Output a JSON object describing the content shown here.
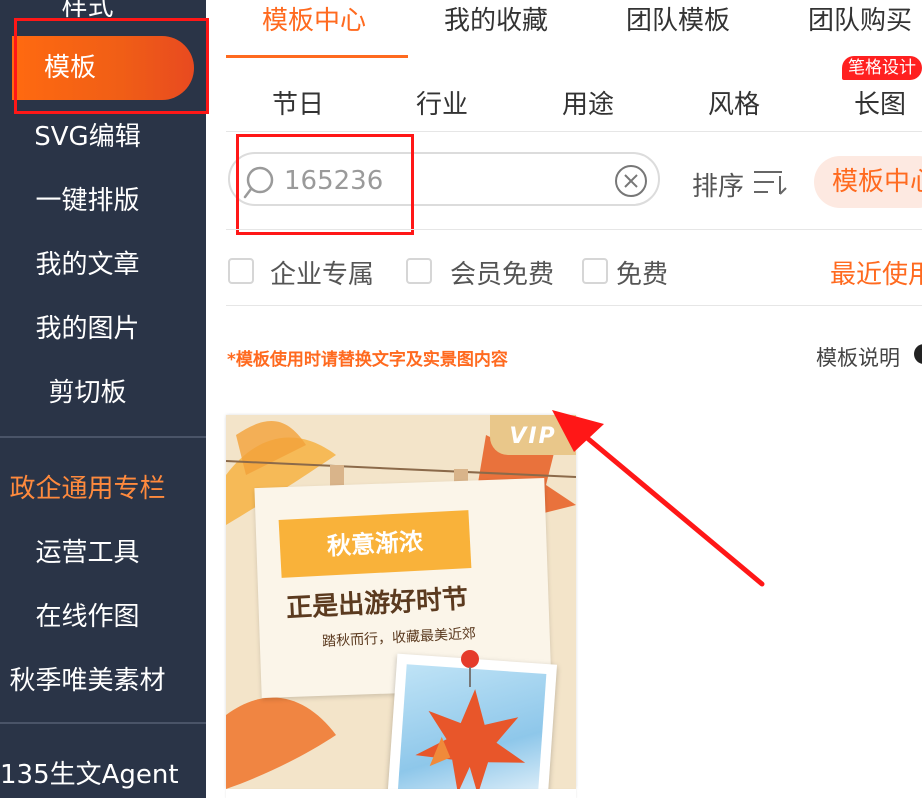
{
  "sidebar": {
    "items": [
      {
        "label": "样式"
      },
      {
        "label": "模板"
      },
      {
        "label": "SVG编辑"
      },
      {
        "label": "一键排版"
      },
      {
        "label": "我的文章"
      },
      {
        "label": "我的图片"
      },
      {
        "label": "剪切板"
      },
      {
        "label": "政企通用专栏"
      },
      {
        "label": "运营工具"
      },
      {
        "label": "在线作图"
      },
      {
        "label": "秋季唯美素材"
      },
      {
        "label": "135生文Agent"
      }
    ]
  },
  "tabs": [
    {
      "label": "模板中心"
    },
    {
      "label": "我的收藏"
    },
    {
      "label": "团队模板"
    },
    {
      "label": "团队购买"
    }
  ],
  "categories": [
    {
      "label": "节日"
    },
    {
      "label": "行业"
    },
    {
      "label": "用途"
    },
    {
      "label": "风格"
    },
    {
      "label": "长图"
    }
  ],
  "long_image_badge": "笔格设计",
  "search": {
    "value": "165236"
  },
  "sort": {
    "label": "排序"
  },
  "source_pill": "模板中心",
  "filters": [
    {
      "label": "企业专属",
      "checked": false
    },
    {
      "label": "会员免费",
      "checked": false
    },
    {
      "label": "免费",
      "checked": false
    }
  ],
  "recent_link": "最近使用",
  "notice": "*模板使用时请替换文字及实景图内容",
  "help_link": "模板说明",
  "template_card": {
    "vip_badge": "VIP",
    "ribbon_text": "秋意渐浓",
    "headline": "正是出游好时节",
    "subline": "踏秋而行，收藏最美近郊"
  },
  "colors": {
    "sidebar_bg": "#2a3447",
    "accent": "#ff6a1f",
    "highlight_box": "#ff1717"
  }
}
